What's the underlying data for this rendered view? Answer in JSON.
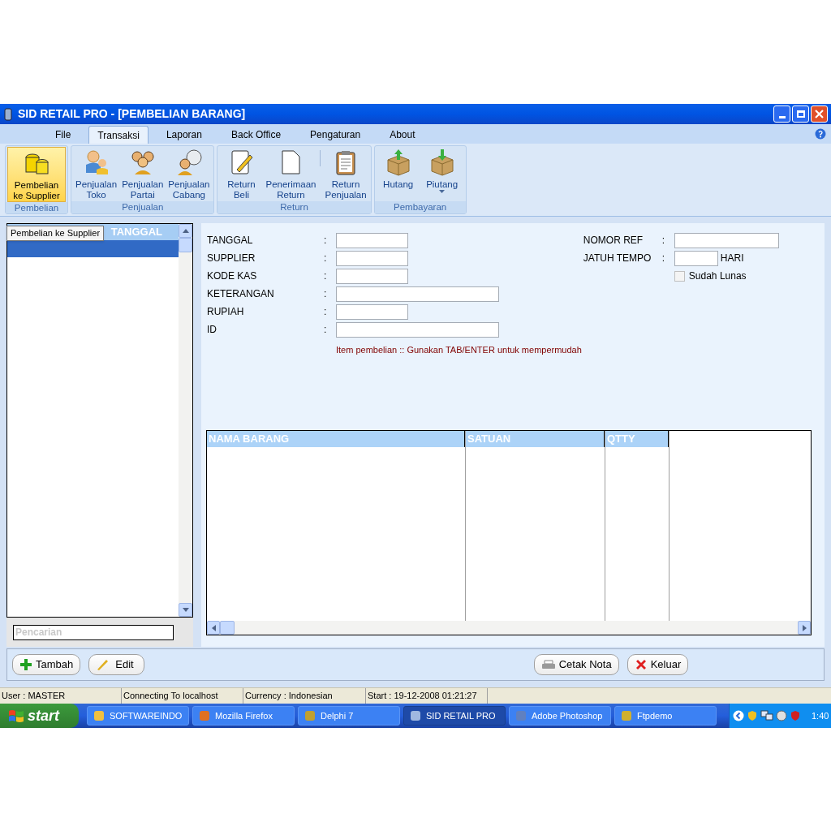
{
  "window": {
    "title": "SID RETAIL PRO - [PEMBELIAN BARANG]"
  },
  "menu_tabs": [
    {
      "label": "File",
      "selected": false
    },
    {
      "label": "Transaksi",
      "selected": true
    },
    {
      "label": "Laporan",
      "selected": false
    },
    {
      "label": "Back Office",
      "selected": false
    },
    {
      "label": "Pengaturan",
      "selected": false
    },
    {
      "label": "About",
      "selected": false
    }
  ],
  "ribbon": {
    "groups": [
      {
        "label": "Pembelian",
        "buttons": [
          {
            "label": "Pembelian ke Supplier",
            "selected": true,
            "dropdown": false
          }
        ]
      },
      {
        "label": "Penjualan",
        "buttons": [
          {
            "label": "Penjualan Toko",
            "selected": false,
            "dropdown": false
          },
          {
            "label": "Penjualan Partai",
            "selected": false,
            "dropdown": false
          },
          {
            "label": "Penjualan Cabang",
            "selected": false,
            "dropdown": false
          }
        ]
      },
      {
        "label": "Return",
        "buttons": [
          {
            "label": "Return Beli",
            "selected": false,
            "dropdown": false
          },
          {
            "label": "Penerimaan Return",
            "selected": false,
            "dropdown": false
          },
          {
            "label": "Return Penjualan",
            "selected": false,
            "dropdown": false
          }
        ]
      },
      {
        "label": "Pembayaran",
        "buttons": [
          {
            "label": "Hutang",
            "selected": false,
            "dropdown": false
          },
          {
            "label": "Piutang",
            "selected": false,
            "dropdown": true
          }
        ]
      }
    ]
  },
  "tooltip": "Pembelian ke Supplier",
  "list": {
    "columns": [
      "TANGGAL"
    ],
    "rows": [
      {
        "selected": true
      }
    ],
    "search_placeholder": "Pencarian"
  },
  "form": {
    "left_fields": [
      {
        "label": "TANGGAL",
        "kind": "short"
      },
      {
        "label": "SUPPLIER",
        "kind": "short"
      },
      {
        "label": "KODE KAS",
        "kind": "short"
      },
      {
        "label": "KETERANGAN",
        "kind": "long"
      },
      {
        "label": "RUPIAH",
        "kind": "short"
      },
      {
        "label": "ID",
        "kind": "long"
      }
    ],
    "right_fields": [
      {
        "label": "NOMOR REF",
        "kind": "long"
      },
      {
        "label": "JATUH TEMPO",
        "kind": "short",
        "suffix": "HARI"
      }
    ],
    "colon": ":",
    "checkbox": {
      "label": "Sudah Lunas",
      "checked": false
    },
    "hint": "Item pembelian :: Gunakan TAB/ENTER untuk mempermudah"
  },
  "table": {
    "columns": [
      "NAMA BARANG",
      "SATUAN",
      "QTTY"
    ]
  },
  "buttons": [
    {
      "label": "Tambah",
      "kind": "add"
    },
    {
      "label": "Edit",
      "kind": "edit"
    },
    {
      "label": "Cetak Nota",
      "kind": "print"
    },
    {
      "label": "Keluar",
      "kind": "exit"
    }
  ],
  "status_bar": [
    "User : MASTER",
    "Connecting To localhost",
    "Currency : Indonesian",
    "Start  : 19-12-2008 01:21:27"
  ],
  "taskbar": {
    "start": "start",
    "tasks": [
      {
        "label": "SOFTWAREINDO",
        "selected": false
      },
      {
        "label": "Mozilla Firefox",
        "selected": false
      },
      {
        "label": "Delphi 7",
        "selected": false
      },
      {
        "label": "SID RETAIL PRO",
        "selected": true
      },
      {
        "label": "Adobe Photoshop",
        "selected": false
      },
      {
        "label": "Ftpdemo",
        "selected": false
      }
    ],
    "clock": "1:40"
  }
}
